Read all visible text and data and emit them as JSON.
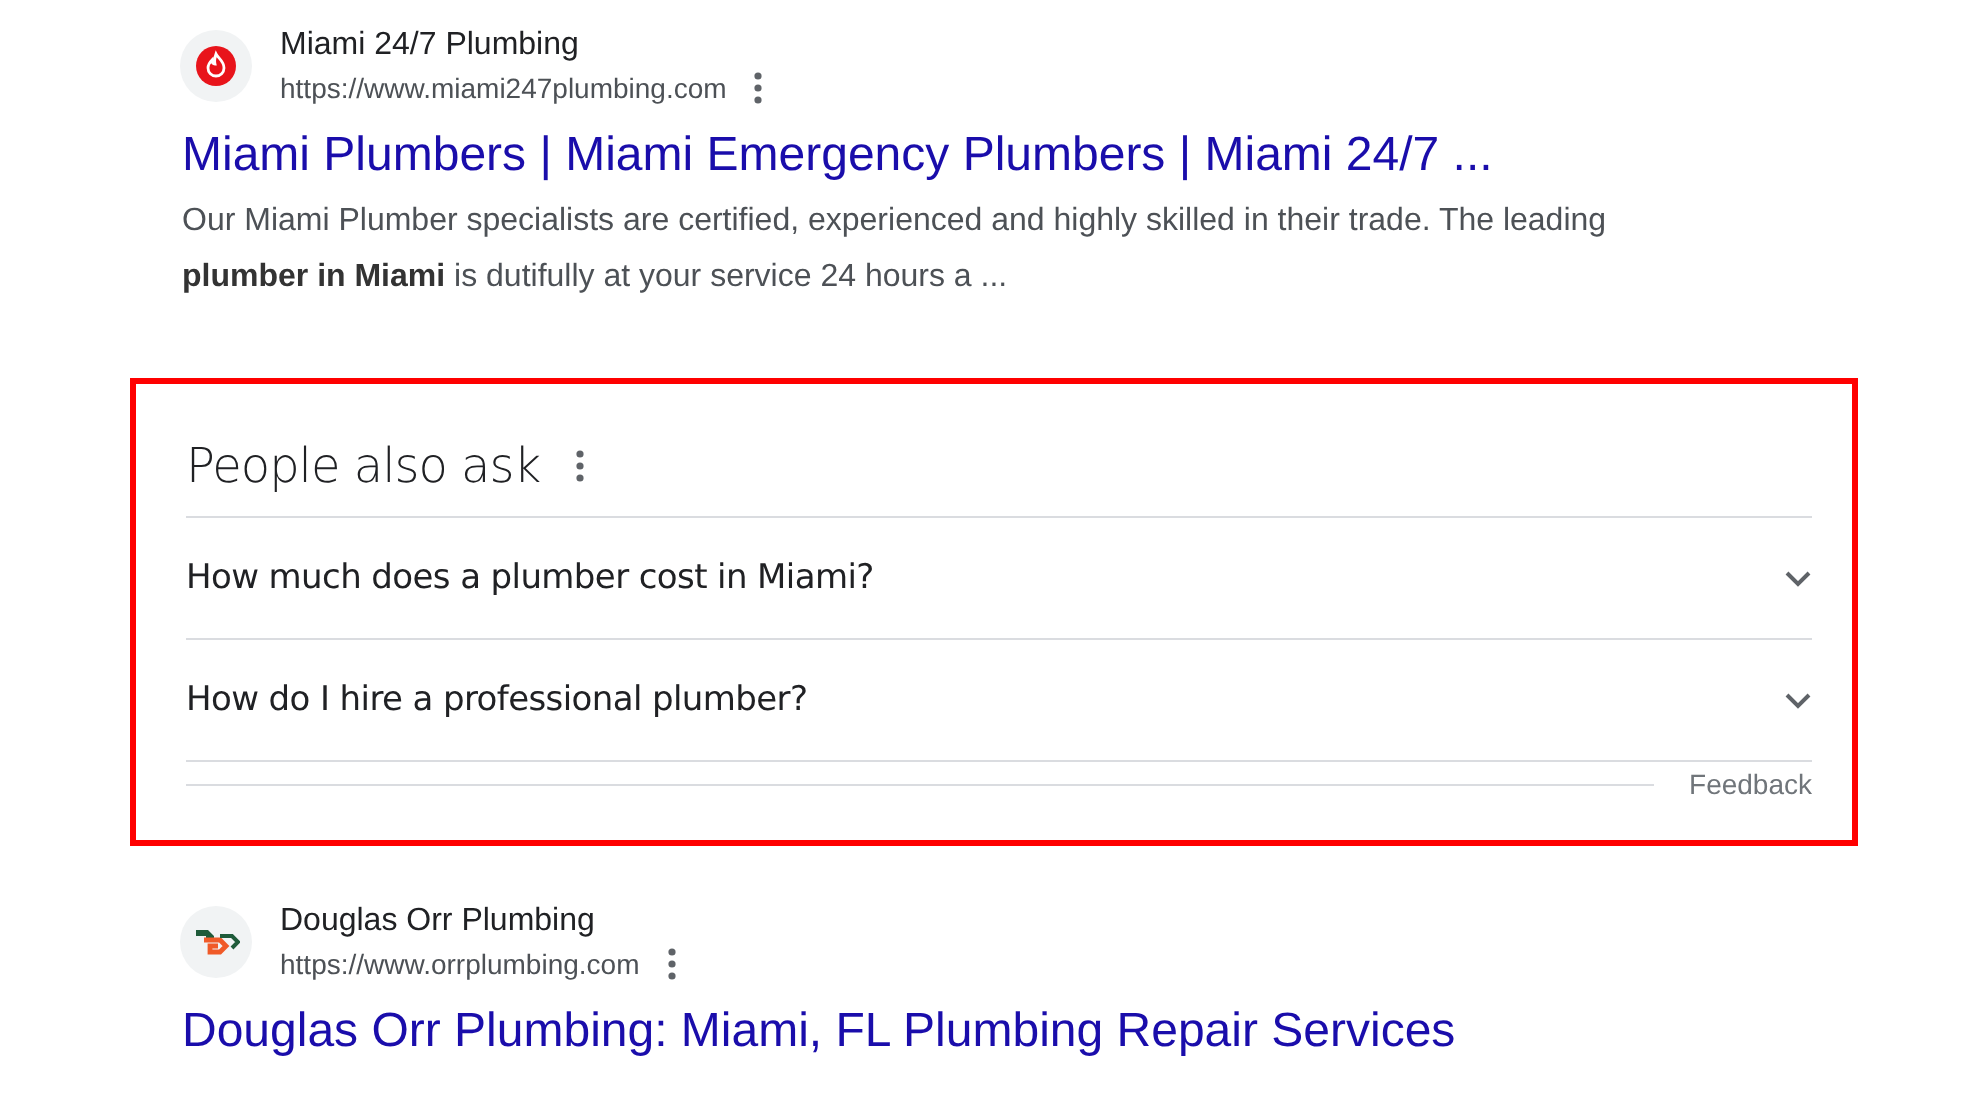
{
  "results_top": [
    {
      "site_name": "Miami 24/7 Plumbing",
      "url": "https://www.miami247plumbing.com",
      "kind": "flame",
      "title": "Miami Plumbers | Miami Emergency Plumbers | Miami 24/7 ...",
      "snippet": "Our Miami Plumber specialists are certified, experienced and highly skilled in their trade. The leading **plumber in Miami** is dutifully at your service 24 hours a ..."
    }
  ],
  "people_also_ask": {
    "heading": "People also ask",
    "highlighted": true,
    "questions": [
      {
        "text": "How much does a plumber cost in Miami?",
        "expanded": false
      },
      {
        "text": "How do I hire a professional plumber?",
        "expanded": false
      }
    ],
    "feedback": "Feedback"
  },
  "results_bottom": [
    {
      "site_name": "Douglas Orr Plumbing",
      "url": "https://www.orrplumbing.com",
      "kind": "monogram",
      "title": "Douglas Orr Plumbing: Miami, FL Plumbing Repair Services"
    }
  ]
}
